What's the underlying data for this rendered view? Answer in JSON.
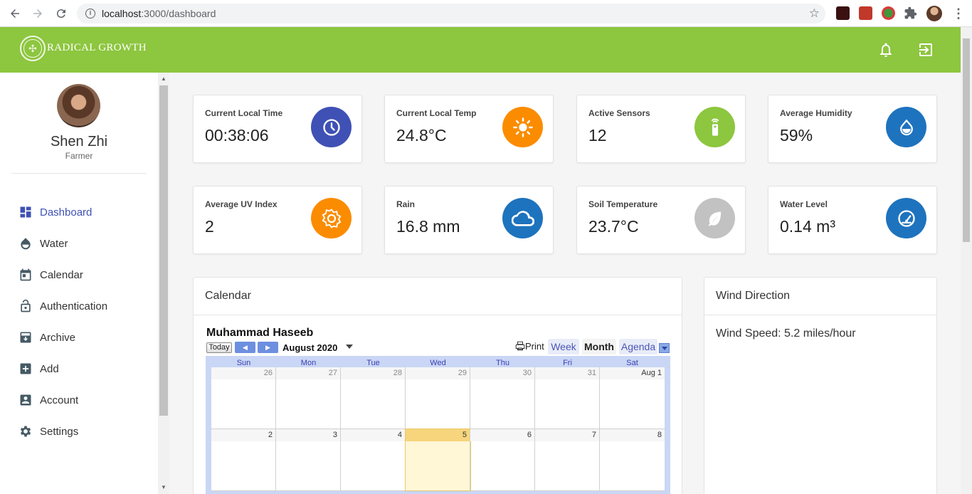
{
  "browser": {
    "url_host": "localhost",
    "url_path": ":3000/dashboard"
  },
  "header": {
    "brand": "RADICAL GROWTH",
    "color": "#8dc63f"
  },
  "user": {
    "name": "Shen Zhi",
    "role": "Farmer"
  },
  "sidebar": {
    "items": [
      {
        "label": "Dashboard",
        "icon": "dashboard-icon",
        "active": true
      },
      {
        "label": "Water",
        "icon": "water-icon"
      },
      {
        "label": "Calendar",
        "icon": "calendar-icon"
      },
      {
        "label": "Authentication",
        "icon": "lock-icon"
      },
      {
        "label": "Archive",
        "icon": "archive-icon"
      },
      {
        "label": "Add",
        "icon": "add-icon"
      },
      {
        "label": "Account",
        "icon": "account-icon"
      },
      {
        "label": "Settings",
        "icon": "gear-icon"
      }
    ]
  },
  "stats": [
    {
      "label": "Current Local Time",
      "value": "00:38:06",
      "icon": "clock-icon",
      "color": "#3f51b5"
    },
    {
      "label": "Current Local Temp",
      "value": "24.8°C",
      "icon": "sun-icon",
      "color": "#fb8c00"
    },
    {
      "label": "Active Sensors",
      "value": "12",
      "icon": "remote-icon",
      "color": "#8dc63f"
    },
    {
      "label": "Average Humidity",
      "value": "59%",
      "icon": "drop-icon",
      "color": "#1e73be"
    },
    {
      "label": "Average UV Index",
      "value": "2",
      "icon": "uv-icon",
      "color": "#fb8c00"
    },
    {
      "label": "Rain",
      "value": "16.8 mm",
      "icon": "cloud-icon",
      "color": "#1e73be"
    },
    {
      "label": "Soil Temperature",
      "value": "23.7°C",
      "icon": "leaf-icon",
      "color": "#c2c2c2"
    },
    {
      "label": "Water Level",
      "value": "0.14 m³",
      "icon": "gauge-icon",
      "color": "#1e73be"
    }
  ],
  "calendar_panel": {
    "title": "Calendar",
    "owner": "Muhammad Haseeb",
    "today_label": "Today",
    "month": "August 2020",
    "print_label": "Print",
    "views": [
      "Week",
      "Month",
      "Agenda"
    ],
    "selected_view": "Month",
    "days_of_week": [
      "Sun",
      "Mon",
      "Tue",
      "Wed",
      "Thu",
      "Fri",
      "Sat"
    ],
    "weeks": [
      [
        "26",
        "27",
        "28",
        "29",
        "30",
        "31",
        "Aug 1"
      ],
      [
        "2",
        "3",
        "4",
        "5",
        "6",
        "7",
        "8"
      ]
    ],
    "today": "5"
  },
  "wind_panel": {
    "title": "Wind Direction",
    "speed_text": "Wind Speed: 5.2 miles/hour"
  }
}
